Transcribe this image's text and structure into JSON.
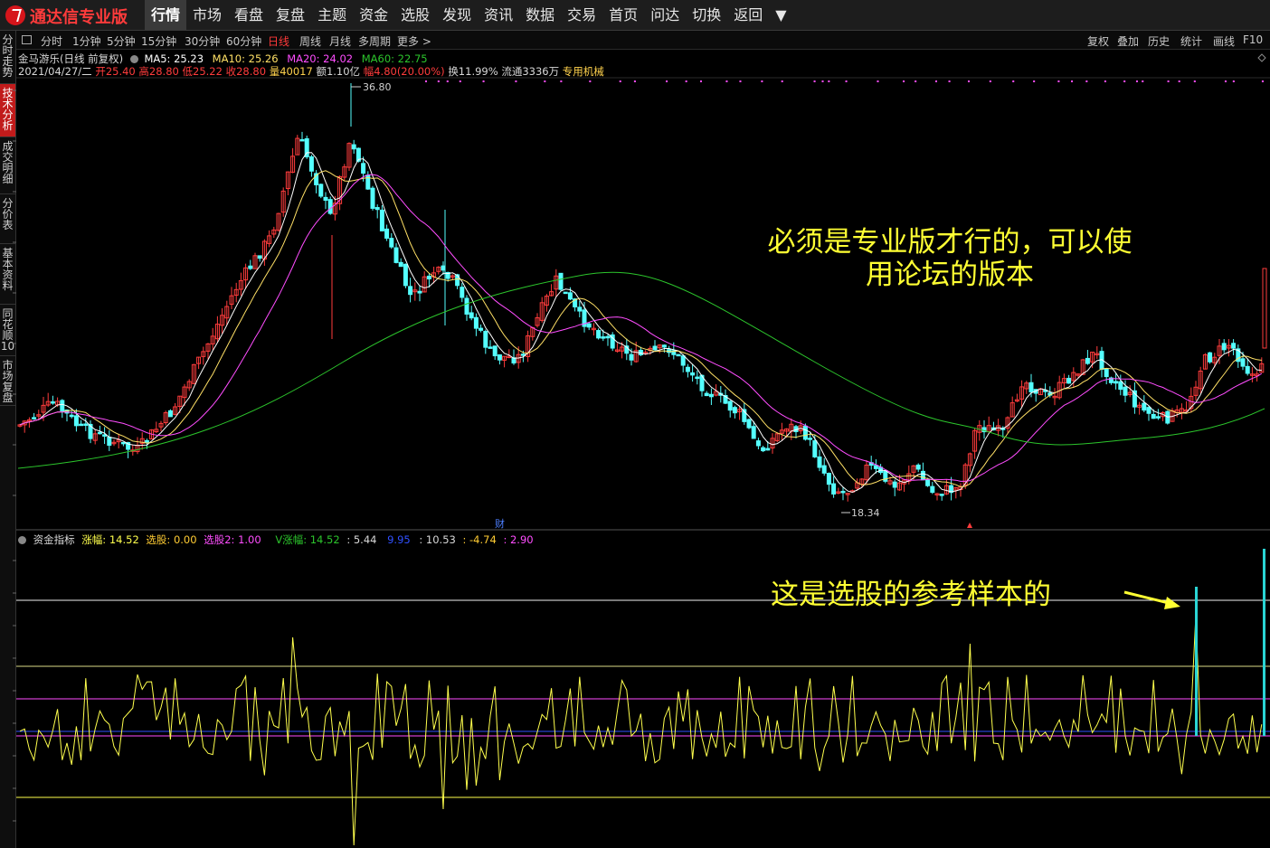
{
  "app": {
    "title": "通达信专业版"
  },
  "menu": [
    "行情",
    "市场",
    "看盘",
    "复盘",
    "主题",
    "资金",
    "选股",
    "发现",
    "资讯",
    "数据",
    "交易",
    "首页",
    "问达",
    "切换",
    "返回",
    "▼"
  ],
  "left_tabs": [
    {
      "label": "分时走势",
      "active": false
    },
    {
      "label": "技术分析",
      "active": true
    },
    {
      "label": "成交明细",
      "active": false
    },
    {
      "label": "分价表",
      "active": false
    },
    {
      "label": "基本资料",
      "active": false
    },
    {
      "label": "同花顺10",
      "active": false
    },
    {
      "label": "市场复盘",
      "active": false
    }
  ],
  "periods": [
    "分时",
    "1分钟",
    "5分钟",
    "15分钟",
    "30分钟",
    "60分钟",
    "日线",
    "周线",
    "月线",
    "多周期",
    "更多 >"
  ],
  "active_period": "日线",
  "right_tools": [
    "复权",
    "叠加",
    "历史",
    "统计",
    "画线",
    "F10"
  ],
  "stock": {
    "name_line": "金马游乐(日线 前复权)",
    "ma5": "MA5: 25.23",
    "ma10": "MA10: 25.26",
    "ma20": "MA20: 24.02",
    "ma60": "MA60: 22.75",
    "date": "2021/04/27/二",
    "open": "开25.40",
    "high": "高28.80",
    "low": "低25.22",
    "close": "收28.80",
    "vol": "量40017",
    "amount": "额1.10亿",
    "change": "幅4.80(20.00%)",
    "turnover": "换11.99%",
    "float": "流通3336万",
    "sector": "专用机械"
  },
  "price_labels": {
    "high": "36.80",
    "low": "18.34",
    "finance_marker": "财"
  },
  "indicator": {
    "name": "资金指标",
    "zf": "涨幅: 14.52",
    "xg": "选股: 0.00",
    "xg2": "选股2: 1.00",
    "vzf": "V涨幅: 14.52",
    "v1": ": 5.44",
    "v2": "9.95",
    "v3": ": 10.53",
    "v4": ": -4.74",
    "v5": ": 2.90"
  },
  "annotations": {
    "top": "必须是专业版才行的，可以使\n用论坛的版本",
    "bottom": "这是选股的参考样本的"
  },
  "colors": {
    "up": "#ff3c3c",
    "down": "#54ffff",
    "ma5": "#ffffff",
    "ma10": "#ffe066",
    "ma20": "#ff4dff",
    "ma60": "#2cc52c",
    "annot": "#ffff33",
    "indicator_line": "#ffff4d"
  }
}
